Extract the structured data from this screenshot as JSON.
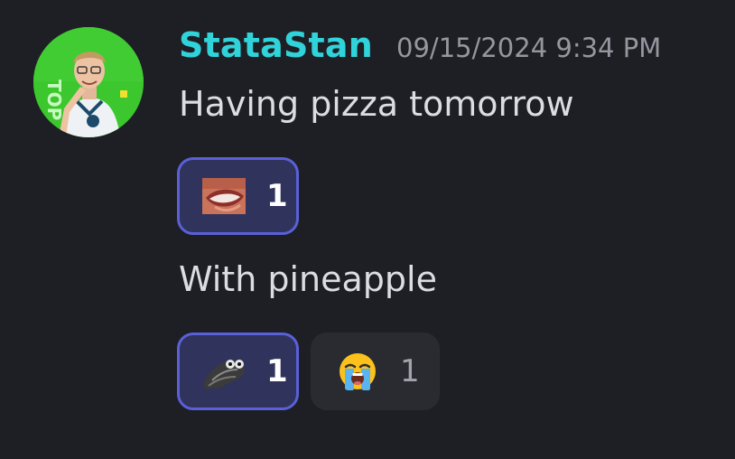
{
  "message": {
    "author": "StataStan",
    "timestamp": "09/15/2024 9:34 PM",
    "avatar_icon": "user-avatar",
    "colors": {
      "username": "#2fd3d9",
      "text": "#dcdde1",
      "timestamp": "#9597a0",
      "reaction_active_bg": "#30335c",
      "reaction_active_border": "#5a60d8",
      "reaction_inactive_bg": "#2a2b31",
      "background": "#1e1f24"
    }
  },
  "lines": [
    {
      "text": "Having pizza tomorrow",
      "reactions": [
        {
          "emoji": "mouth-custom-emoji",
          "count": "1",
          "reacted": true
        }
      ]
    },
    {
      "text": "With pineapple",
      "reactions": [
        {
          "emoji": "frog-custom-emoji",
          "count": "1",
          "reacted": true
        },
        {
          "emoji": "loudly-crying-face-emoji",
          "count": "1",
          "reacted": false
        }
      ]
    }
  ]
}
